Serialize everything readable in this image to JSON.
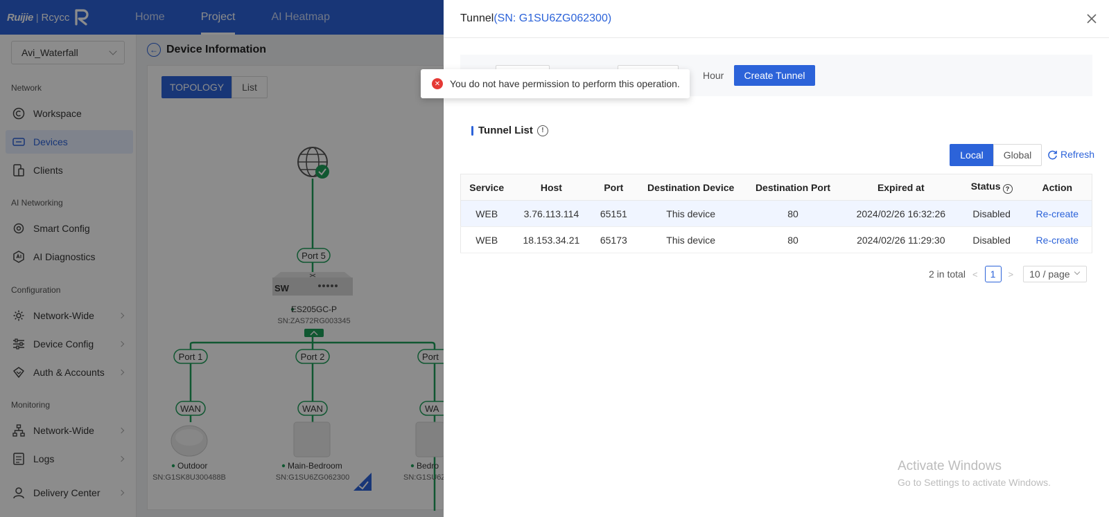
{
  "brand": {
    "name": "Ruijie",
    "sub": "Rcycc"
  },
  "nav": {
    "tabs": [
      {
        "label": "Home"
      },
      {
        "label": "Project"
      },
      {
        "label": "AI Heatmap"
      }
    ]
  },
  "sidebar": {
    "site": "Avi_Waterfall",
    "sections": [
      "Network",
      "AI Networking",
      "Configuration",
      "Monitoring"
    ],
    "items": [
      {
        "label": "Workspace",
        "icon": "workspace-icon"
      },
      {
        "label": "Devices",
        "icon": "devices-icon"
      },
      {
        "label": "Clients",
        "icon": "clients-icon"
      },
      {
        "label": "Smart Config",
        "icon": "smart-config-icon"
      },
      {
        "label": "AI Diagnostics",
        "icon": "ai-diagnostics-icon"
      },
      {
        "label": "Network-Wide",
        "icon": "gear-icon"
      },
      {
        "label": "Device Config",
        "icon": "sliders-icon"
      },
      {
        "label": "Auth & Accounts",
        "icon": "shield-icon"
      },
      {
        "label": "Network-Wide",
        "icon": "hierarchy-icon"
      },
      {
        "label": "Logs",
        "icon": "logs-icon"
      },
      {
        "label": "Delivery Center",
        "icon": "delivery-icon"
      }
    ]
  },
  "main": {
    "title": "Device Information",
    "view_tabs": [
      "TOPOLOGY",
      "List"
    ],
    "topology": {
      "switch_label": "SW",
      "switch_port": "Port 5",
      "switch_name": "ES205GC-P",
      "switch_sn": "SN:ZAS72RG003345",
      "ports": [
        "Port 1",
        "Port 2",
        "Port"
      ],
      "wan": [
        "WAN",
        "WAN",
        "WA"
      ],
      "devices": [
        {
          "name": "Outdoor",
          "sn": "SN:G1SK8U300488B"
        },
        {
          "name": "Main-Bedroom",
          "sn": "SN:G1SU6ZG062300"
        },
        {
          "name": "Bedro",
          "sn": "SN:G1SU6Z"
        }
      ]
    }
  },
  "drawer": {
    "title": "Tunnel",
    "sn": "(SN: G1SU6ZG062300)",
    "hour_label": "Hour",
    "create_label": "Create Tunnel",
    "list_title": "Tunnel List",
    "scope": [
      "Local",
      "Global"
    ],
    "refresh_label": "Refresh",
    "table": {
      "headers": [
        "Service",
        "Host",
        "Port",
        "Destination Device",
        "Destination Port",
        "Expired at",
        "Status",
        "Action"
      ],
      "rows": [
        [
          "WEB",
          "3.76.113.114",
          "65151",
          "This device",
          "80",
          "2024/02/26 16:32:26",
          "Disabled",
          "Re-create"
        ],
        [
          "WEB",
          "18.153.34.21",
          "65173",
          "This device",
          "80",
          "2024/02/26 11:29:30",
          "Disabled",
          "Re-create"
        ]
      ]
    },
    "pagination": {
      "total": "2 in total",
      "page": "1",
      "size": "10 / page"
    }
  },
  "toast": {
    "message": "You do not have permission to perform this operation."
  },
  "watermark": {
    "line1": "Activate Windows",
    "line2": "Go to Settings to activate Windows."
  },
  "colors": {
    "primary": "#2c63d9",
    "online": "#1e9e5a",
    "error": "#e53935"
  }
}
